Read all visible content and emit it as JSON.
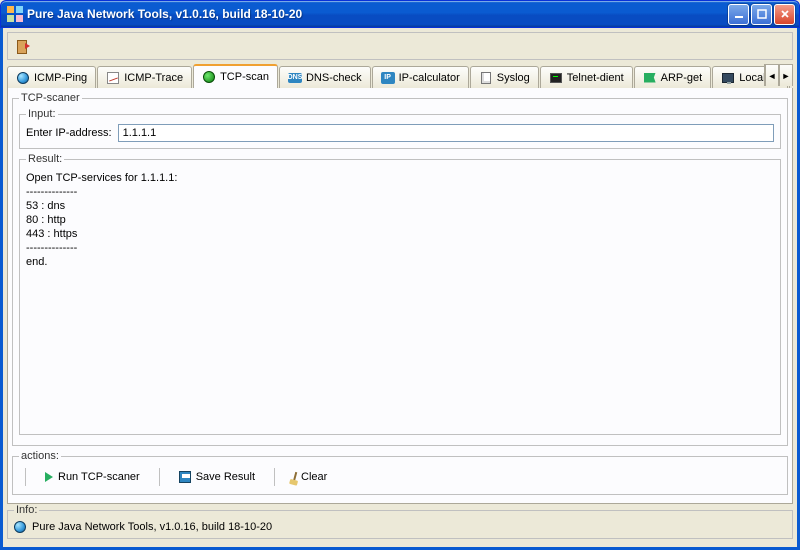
{
  "window": {
    "title": "Pure Java Network Tools,  v1.0.16, build 18-10-20"
  },
  "tabs": [
    {
      "label": "ICMP-Ping"
    },
    {
      "label": "ICMP-Trace"
    },
    {
      "label": "TCP-scan"
    },
    {
      "label": "DNS-check",
      "abbr": "DNS"
    },
    {
      "label": "IP-calculator",
      "abbr": "IP"
    },
    {
      "label": "Syslog"
    },
    {
      "label": "Telnet-dient"
    },
    {
      "label": "ARP-get"
    },
    {
      "label": "Local IP"
    }
  ],
  "scanner": {
    "legend": "TCP-scaner",
    "input_legend": "Input:",
    "input_label": "Enter IP-address:",
    "input_value": "1.1.1.1",
    "result_legend": "Result:",
    "result_text": "Open TCP-services for 1.1.1.1:\n--------------\n53 : dns\n80 : http\n443 : https\n--------------\nend."
  },
  "actions": {
    "legend": "actions:",
    "run": "Run TCP-scaner",
    "save": "Save Result",
    "clear": "Clear"
  },
  "info": {
    "legend": "Info:",
    "text": "Pure Java Network Tools,  v1.0.16, build 18-10-20"
  }
}
